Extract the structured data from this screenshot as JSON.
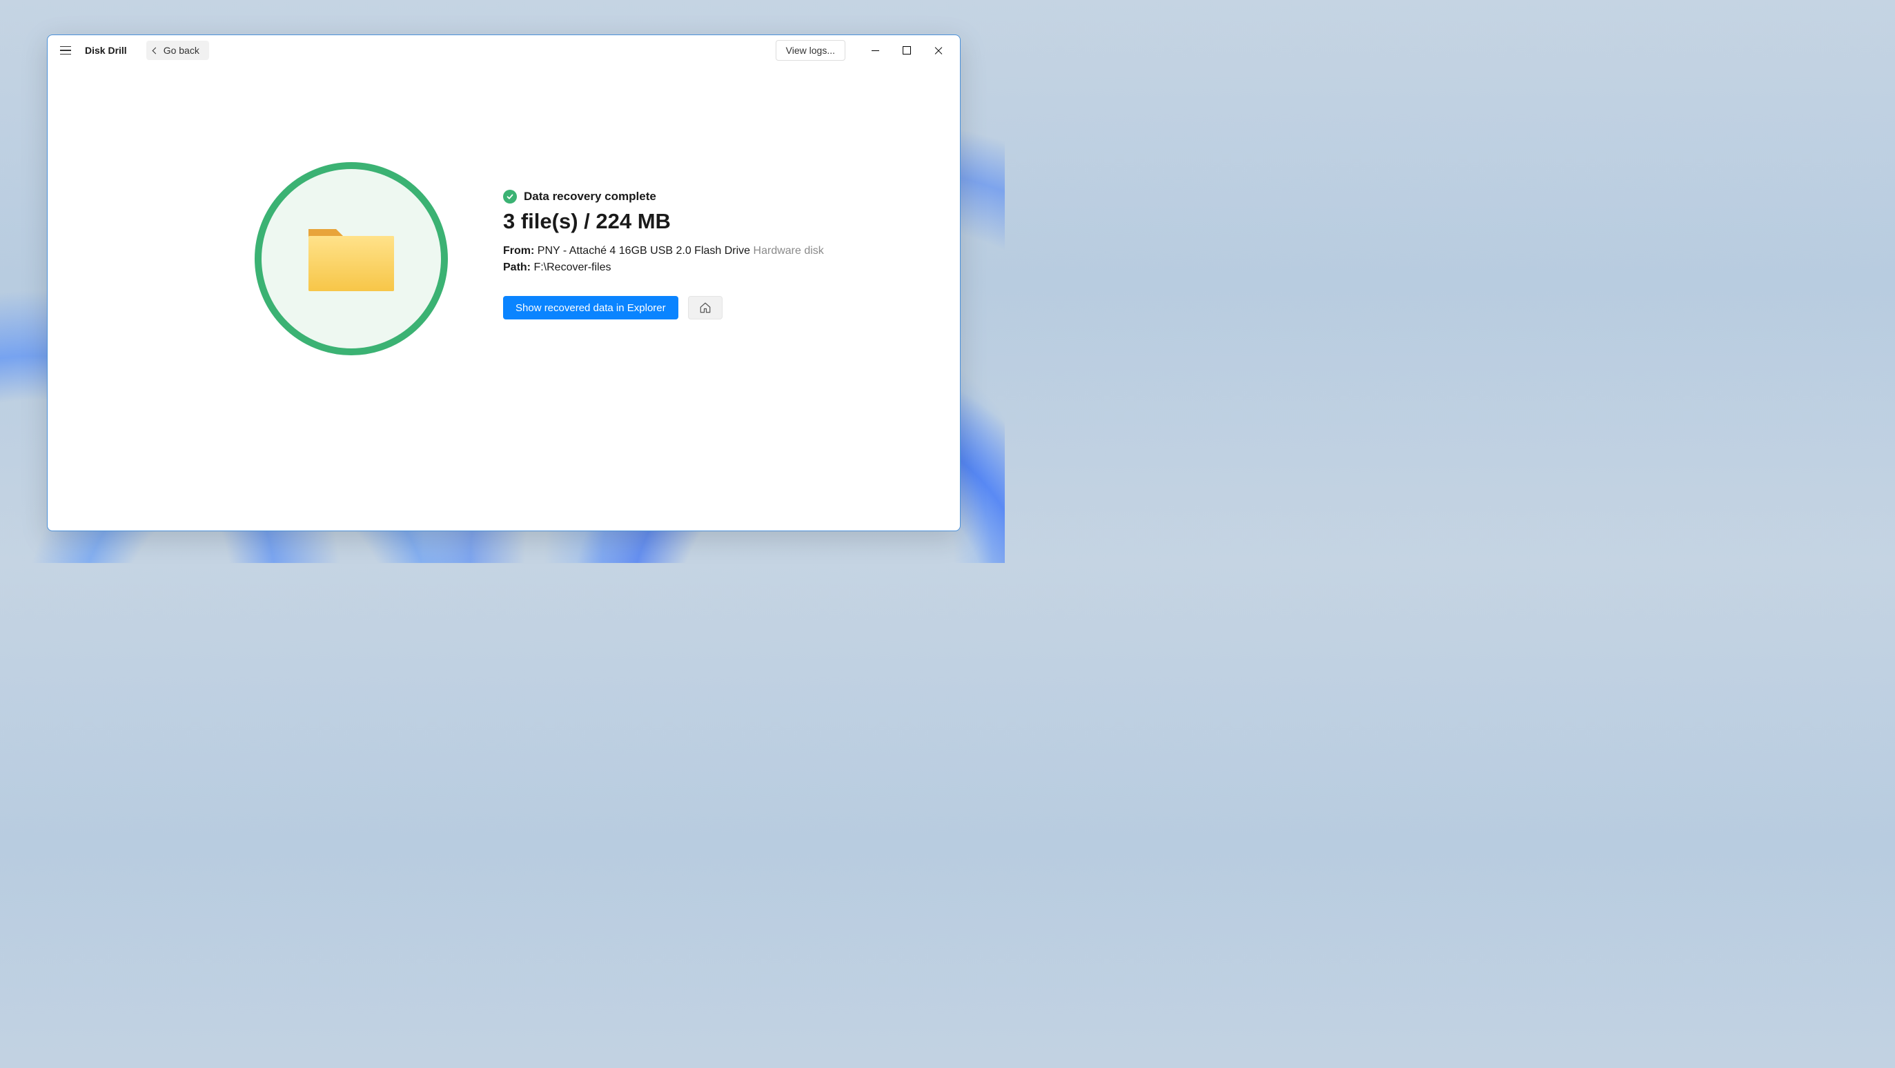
{
  "header": {
    "app_title": "Disk Drill",
    "go_back_label": "Go back",
    "view_logs_label": "View logs..."
  },
  "result": {
    "status_text": "Data recovery complete",
    "summary": "3 file(s) / 224 MB",
    "from_label": "From:",
    "from_value": "PNY - Attaché 4 16GB USB 2.0 Flash Drive",
    "from_type": "Hardware disk",
    "path_label": "Path:",
    "path_value": "F:\\Recover-files",
    "show_button": "Show recovered data in Explorer"
  },
  "colors": {
    "accent_blue": "#0a84ff",
    "success_green": "#3bb273"
  }
}
